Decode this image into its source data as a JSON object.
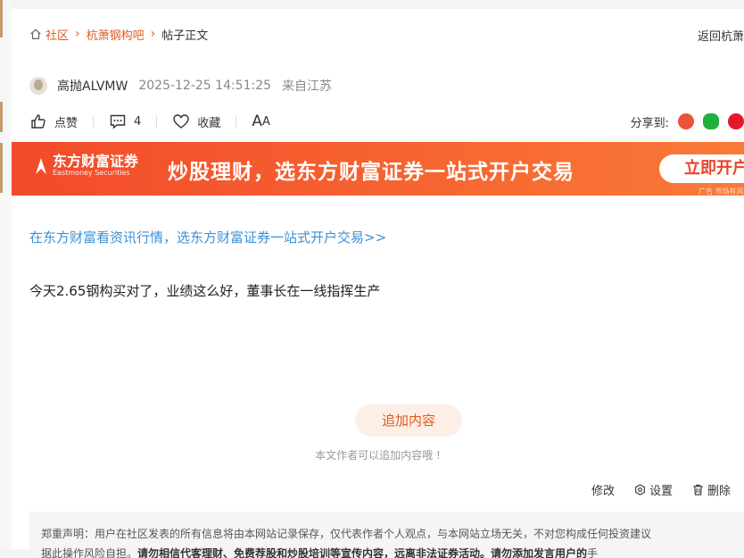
{
  "breadcrumb": {
    "items": [
      {
        "label": "社区"
      },
      {
        "label": "杭萧钢构吧"
      }
    ],
    "current": "帖子正文"
  },
  "header": {
    "back_label": "返回杭萧"
  },
  "post": {
    "author": "高抛ALVMW",
    "time": "2025-12-25 14:51:25",
    "location": "来自江苏",
    "promo_link": "在东方财富看资讯行情，选东方财富证券一站式开户交易>>",
    "content": "今天2.65钢构买对了，业绩这么好，董事长在一线指挥生产"
  },
  "actions": {
    "like_label": "点赞",
    "comment_count": "4",
    "collect_label": "收藏",
    "fontsize_big": "A",
    "fontsize_small": "A",
    "share_label": "分享到:"
  },
  "banner": {
    "brand_zh": "东方财富证券",
    "brand_en": "Eastmoney Securities",
    "slogan": "炒股理财，选东方财富证券一站式开户交易",
    "cta_label": "立即开户",
    "ad_note": "广告 市场有风险"
  },
  "append": {
    "button_label": "追加内容",
    "tip": "本文作者可以追加内容哦 !"
  },
  "ops": {
    "edit_label": "修改",
    "settings_label": "设置",
    "delete_label": "删除"
  },
  "disclaimer": {
    "line1": "郑重声明：用户在社区发表的所有信息将由本网站记录保存，仅代表作者个人观点，与本网站立场无关，不对您构成任何投资建议",
    "line2_a": "据此操作风险自担。",
    "line2_b": "请勿相信代客理财、免费荐股和炒股培训等宣传内容，远离非法证券活动。请勿添加发言用户的",
    "line2_c": "手"
  },
  "colors": {
    "accent": "#e35b1f",
    "link": "#3b8fd6",
    "banner_start": "#f24a2a",
    "banner_end": "#f97a38"
  }
}
